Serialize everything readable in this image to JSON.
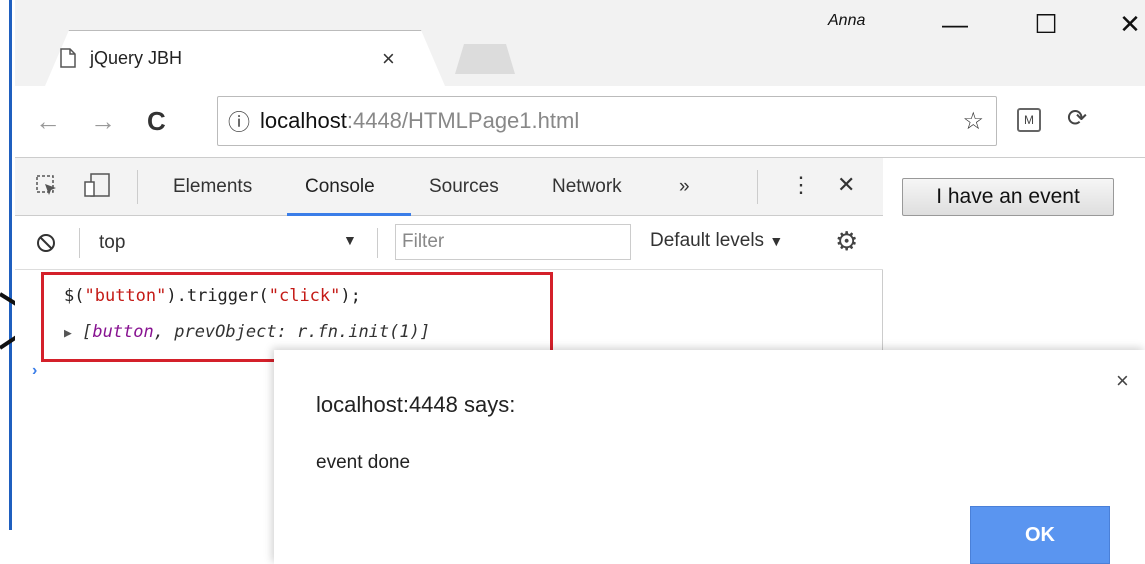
{
  "window": {
    "user": "Anna",
    "minimize_icon": "—",
    "maximize_icon": "☐",
    "close_icon": "✕"
  },
  "tab": {
    "title": "jQuery JBH",
    "close": "×"
  },
  "toolbar": {
    "back": "←",
    "forward": "→",
    "reload": "C",
    "info_icon": "ⓘ",
    "url_host": "localhost",
    "url_rest": ":4448/HTMLPage1.html",
    "star": "☆",
    "ext1": "M",
    "ext2": "⟳"
  },
  "devtools": {
    "tabs": [
      "Elements",
      "Console",
      "Sources",
      "Network",
      "»"
    ],
    "active_tab": "Console",
    "menu": "⋮",
    "close": "✕",
    "context": "top",
    "context_arrow": "▼",
    "filter_placeholder": "Filter",
    "levels": "Default levels",
    "levels_arrow": "▼",
    "settings_icon": "⚙",
    "block_icon": "⃠",
    "console": {
      "input_prefix": "$(",
      "input_arg": "\"button\"",
      "input_mid": ").trigger(",
      "input_arg2": "\"click\"",
      "input_suffix": ");",
      "output_arrow": "▶",
      "output_open": "[",
      "output_button": "button",
      "output_rest": ", prevObject: r.fn.init(1)]",
      "prompt": "›"
    }
  },
  "page": {
    "button_label": "I have an event"
  },
  "dialog": {
    "title": "localhost:4448 says:",
    "message": "event done",
    "ok": "OK",
    "close": "×"
  },
  "colors": {
    "accent": "#3a7de8",
    "highlight": "#d4202a",
    "ok_button": "#5a95f0",
    "string": "#c41a16",
    "keyword": "#881391"
  }
}
